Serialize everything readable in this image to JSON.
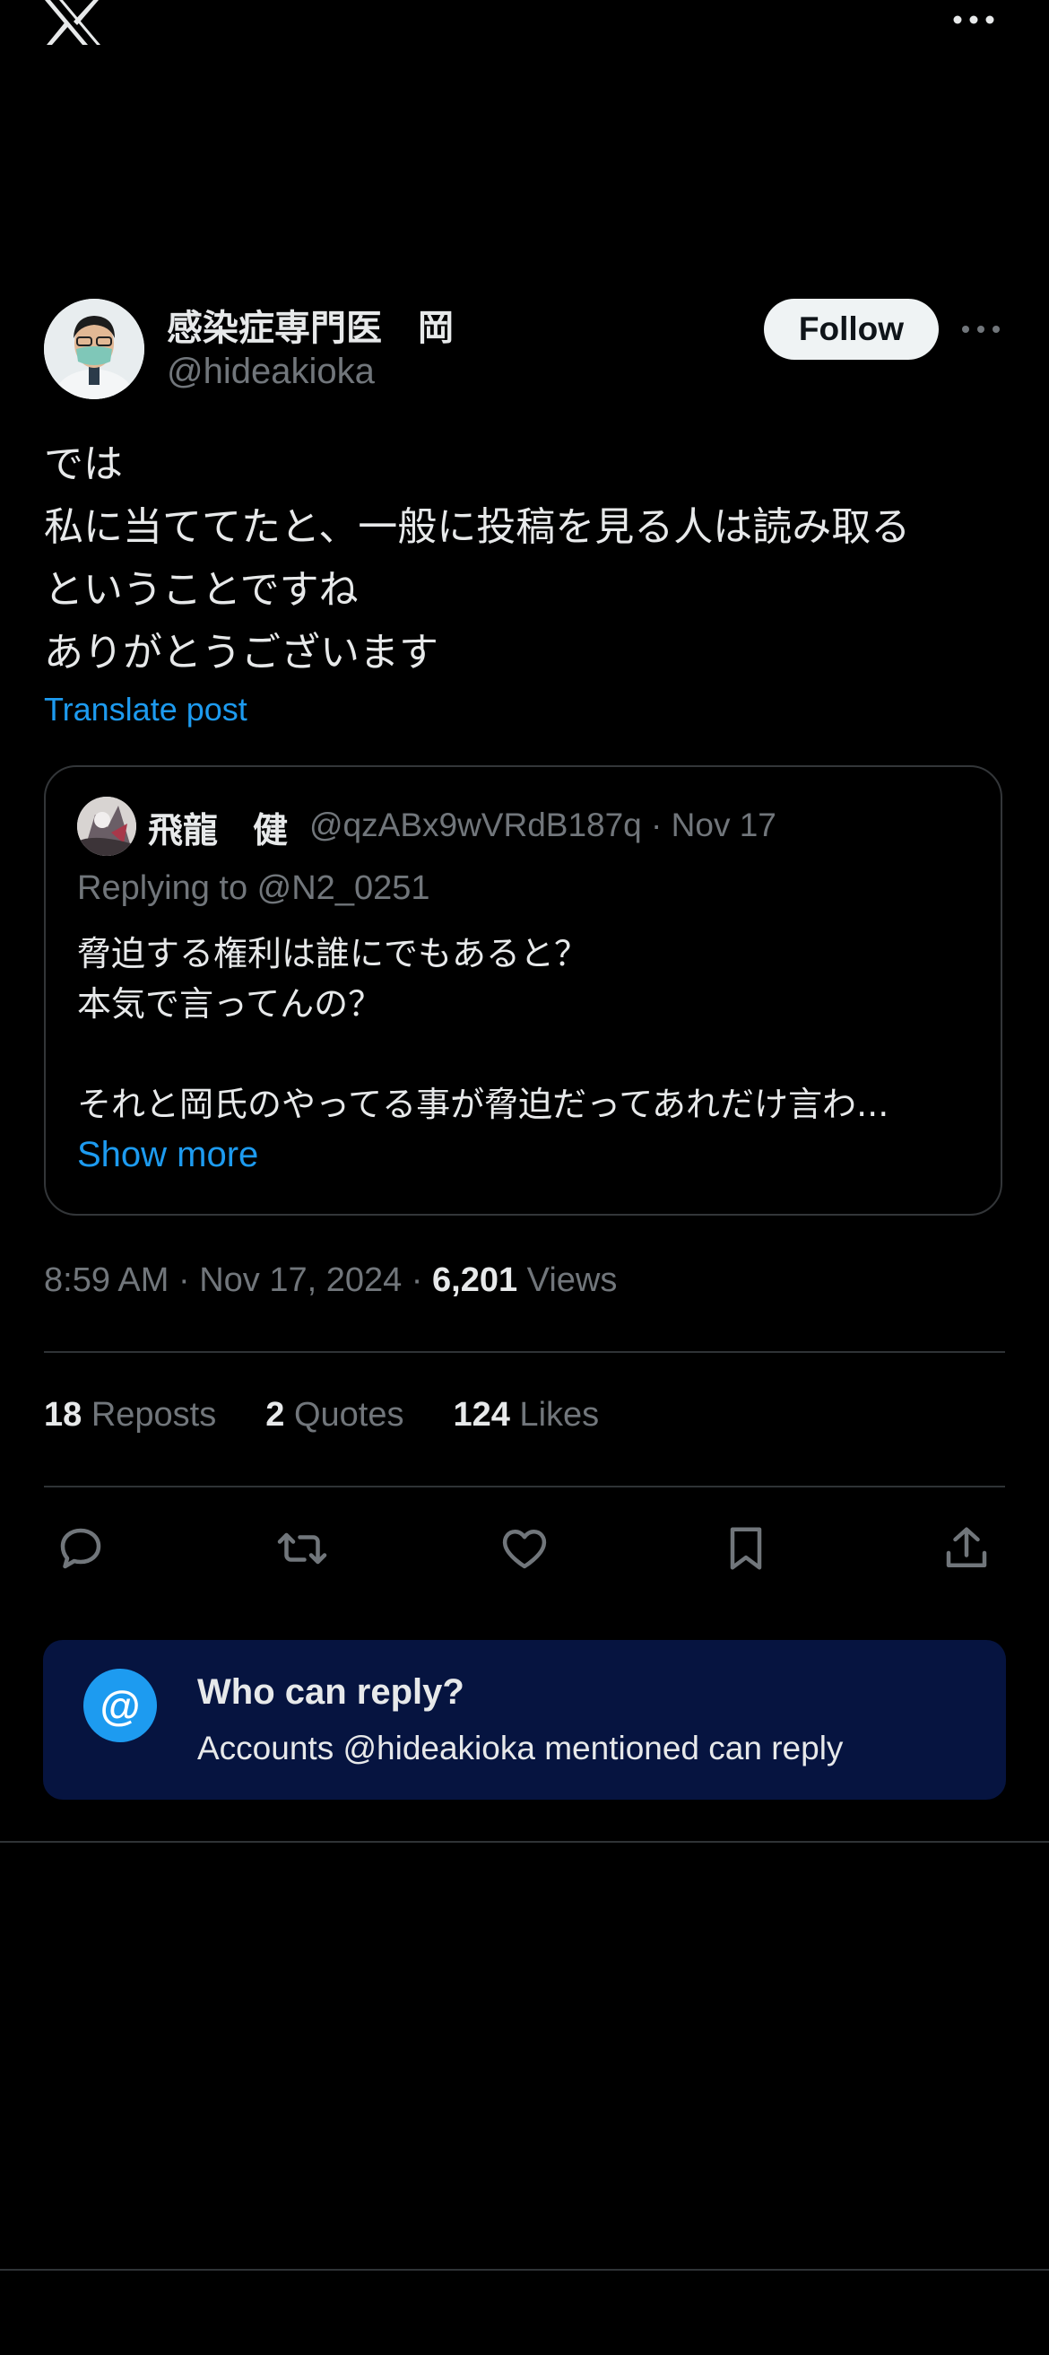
{
  "header": {
    "logo_icon": "x-logo-icon",
    "more_icon": "more-horizontal-icon"
  },
  "post": {
    "author_name": "感染症専門医　岡",
    "author_handle": "@hideakioka",
    "follow_label": "Follow",
    "body_lines": [
      "では",
      "私に当ててたと、一般に投稿を見る人は読み取る",
      "ということですね",
      "ありがとうございます"
    ],
    "translate_label": "Translate post"
  },
  "quote": {
    "author_name": "飛龍　健",
    "meta": "@qzABx9wVRdB187q · Nov 17",
    "replying_to": "Replying to @N2_0251",
    "body_lines": [
      "脅迫する権利は誰にでもあると？",
      "本気で言ってんの？",
      "",
      "それと岡氏のやってる事が脅迫だってあれだけ言わ..."
    ],
    "show_more_label": "Show more"
  },
  "meta": {
    "time_date": "8:59 AM · Nov 17, 2024 · ",
    "views_count": "6,201",
    "views_label": " Views"
  },
  "stats": {
    "reposts_count": "18",
    "reposts_label": " Reposts",
    "quotes_count": "2",
    "quotes_label": " Quotes",
    "likes_count": "124",
    "likes_label": " Likes"
  },
  "actions": [
    "reply-icon",
    "repost-icon",
    "like-icon",
    "bookmark-icon",
    "share-icon"
  ],
  "who_can_reply": {
    "icon": "@",
    "title": "Who can reply?",
    "subtitle": "Accounts @hideakioka mentioned can reply"
  },
  "colors": {
    "accent": "#1d9bf0",
    "background": "#000000",
    "muted": "#71767b",
    "banner": "#061440"
  }
}
